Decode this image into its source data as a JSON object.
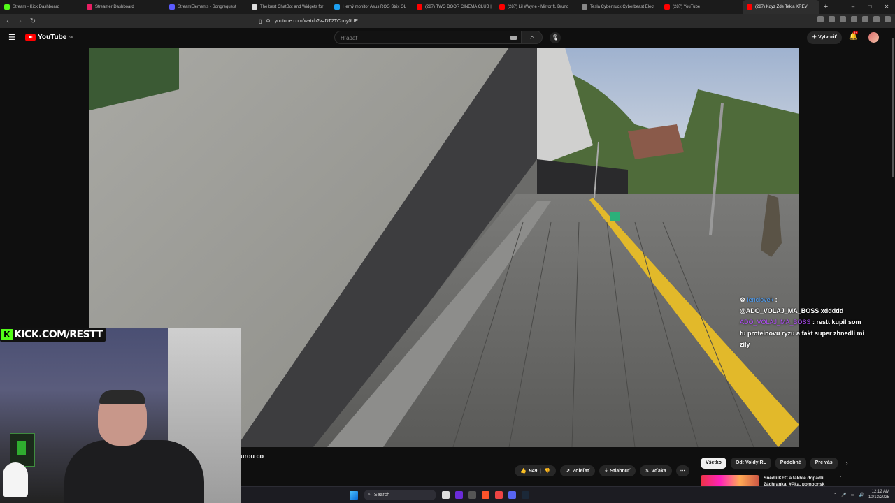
{
  "browser": {
    "tabs": [
      {
        "title": "Stream - Kick Dashboard",
        "color": "#53fc18"
      },
      {
        "title": "Streamer Dashboard",
        "color": "#e91e63"
      },
      {
        "title": "StreamElements - Songrequest",
        "color": "#5b5bff"
      },
      {
        "title": "The best ChatBot and Widgets for",
        "color": "#dddddd"
      },
      {
        "title": "Herný monitor Asus ROG Strix OL",
        "color": "#1ca0f2"
      },
      {
        "title": "(287) TWO DOOR CINEMA CLUB |",
        "color": "#ff0000"
      },
      {
        "title": "(287) Lil Wayne - Mirror ft. Bruno",
        "color": "#ff0000"
      },
      {
        "title": "Tesla Cybertruck Cyberbeast Elect",
        "color": "#888888"
      },
      {
        "title": "(287) YouTube",
        "color": "#ff0000"
      },
      {
        "title": "(287) Kdyz Zde Tekla KREV",
        "color": "#ff0000",
        "active": true
      }
    ],
    "new_tab": "+",
    "window_controls": {
      "minimize": "–",
      "maximize": "□",
      "close": "✕"
    },
    "url": "youtube.com/watch?v=DT2TCuny0UE"
  },
  "youtube": {
    "logo_text": "YouTube",
    "logo_region": "SK",
    "search_placeholder": "Hľadať",
    "create_label": "Vytvoriť",
    "notif_badge": "9+"
  },
  "overlay": {
    "kick_label": "KICK.COM/RESTT",
    "chat": [
      {
        "user": "lenclovek",
        "text": "@ADO_VOLAJ_MA_BOSS xddddd"
      },
      {
        "user": "ADO_VOLAJ_MA_BOSS",
        "text": "restt kupil som tu proteinovu ryzu a fakt super zhnedli mi zily"
      }
    ]
  },
  "video": {
    "title_fragment": "urou co",
    "likes": "949",
    "share_label": "Zdieľať",
    "download_label": "Stiahnuť",
    "thanks_label": "Vďaka",
    "more": "⋯"
  },
  "sidebar": {
    "chips": [
      {
        "label": "Všetko",
        "selected": true
      },
      {
        "label": "Od: VoldyIRL"
      },
      {
        "label": "Podobné"
      },
      {
        "label": "Pre vás"
      }
    ],
    "recommendation_title": "Snědli KFC a takhle dopadli. Záchranka, #Pka, pomocnsk"
  },
  "taskbar": {
    "search_label": "Search",
    "time": "12:12 AM",
    "date": "10/13/2025"
  }
}
